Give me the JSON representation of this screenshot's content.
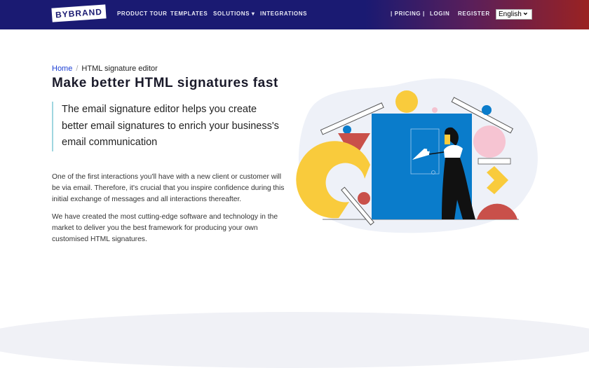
{
  "header": {
    "logo": "BYBRAND",
    "nav": [
      "PRODUCT TOUR",
      "TEMPLATES",
      "SOLUTIONS",
      "INTEGRATIONS"
    ],
    "right": [
      "| PRICING |",
      "LOGIN",
      "REGISTER"
    ],
    "language": "English"
  },
  "breadcrumb": {
    "home": "Home",
    "separator": "/",
    "current": "HTML signature editor"
  },
  "title": "Make better HTML signatures fast",
  "lead": "The email signature editor helps you create better email signatures to enrich your business's email communication",
  "paragraphs": [
    "One of the first interactions you'll have with a new client or customer will be via email. Therefore, it's crucial that you inspire confidence during this initial exchange of messages and all interactions thereafter.",
    "We have created the most cutting-edge software and technology in the market to deliver you the best framework for producing your own customised HTML signatures."
  ],
  "colors": {
    "header_start": "#1a1a72",
    "header_end": "#9a2222",
    "link": "#1c3fd4",
    "door": "#0a7ccb"
  }
}
